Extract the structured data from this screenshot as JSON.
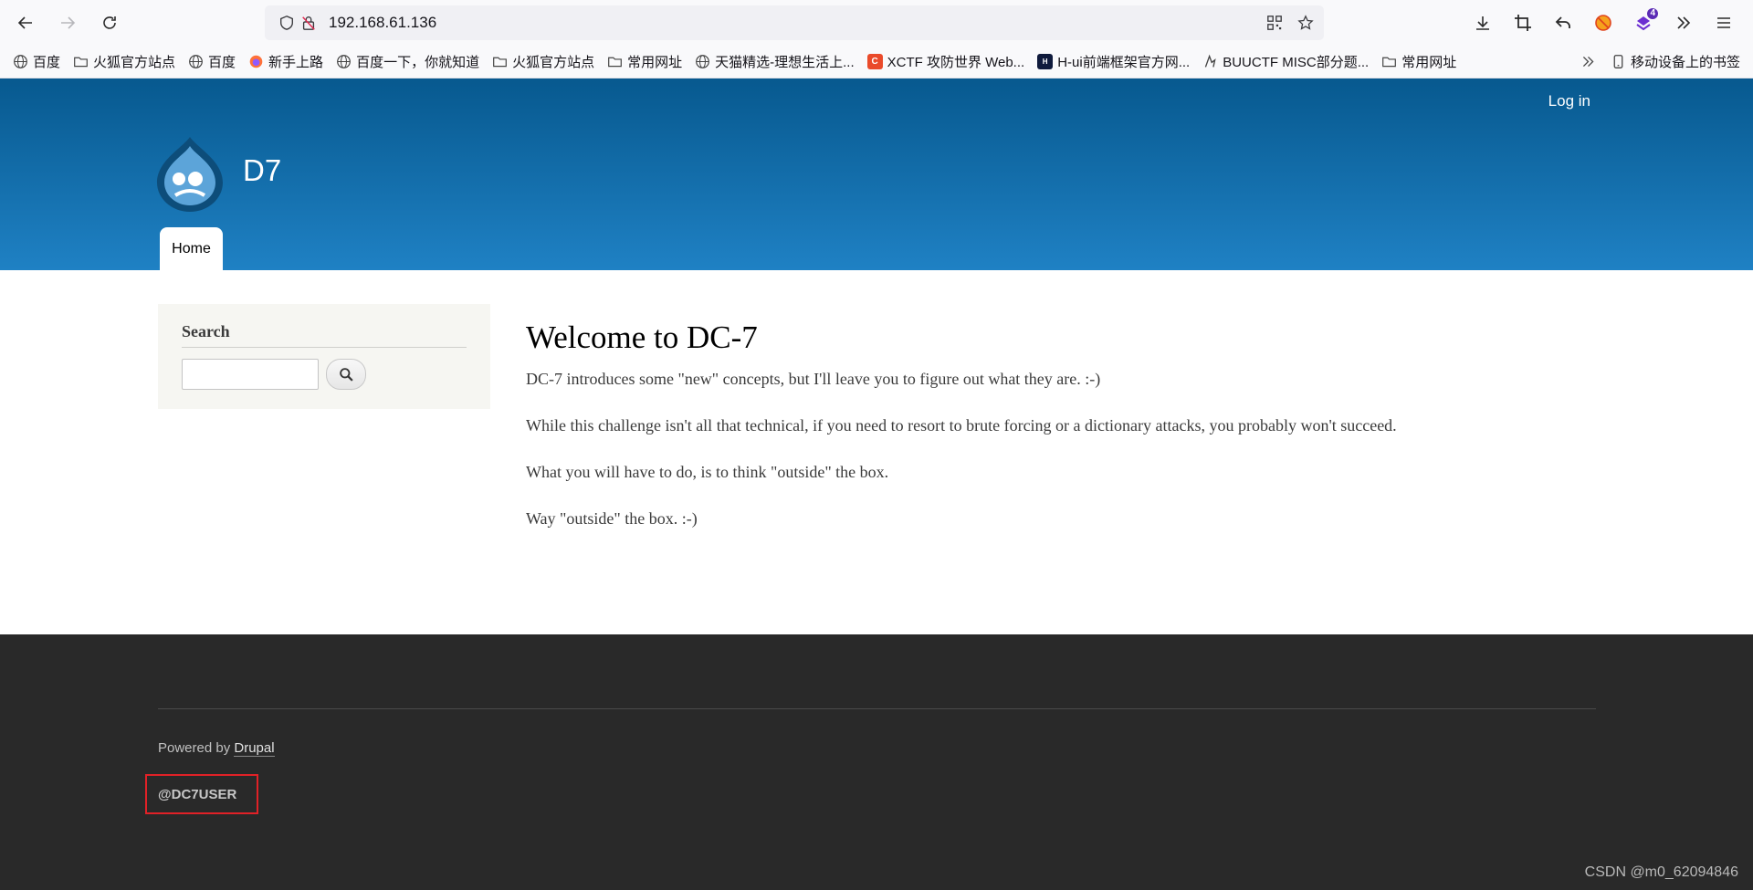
{
  "browser": {
    "url": "192.168.61.136",
    "extension_badge": "4",
    "bookmarks": [
      {
        "label": "百度",
        "icon": "globe-icon"
      },
      {
        "label": "火狐官方站点",
        "icon": "folder-icon"
      },
      {
        "label": "百度",
        "icon": "globe-icon"
      },
      {
        "label": "新手上路",
        "icon": "firefox-icon"
      },
      {
        "label": "百度一下，你就知道",
        "icon": "globe-icon"
      },
      {
        "label": "火狐官方站点",
        "icon": "folder-icon"
      },
      {
        "label": "常用网址",
        "icon": "folder-icon"
      },
      {
        "label": "天猫精选-理想生活上...",
        "icon": "globe-icon"
      },
      {
        "label": "XCTF 攻防世界 Web...",
        "icon": "xctf-icon"
      },
      {
        "label": "H-ui前端框架官方网...",
        "icon": "hui-icon"
      },
      {
        "label": "BUUCTF MISC部分题...",
        "icon": "buu-icon"
      },
      {
        "label": "常用网址",
        "icon": "folder-icon"
      }
    ],
    "mobile_bookmarks": "移动设备上的书签"
  },
  "site": {
    "login": "Log in",
    "name": "D7",
    "nav_home": "Home"
  },
  "sidebar": {
    "search_title": "Search"
  },
  "content": {
    "title": "Welcome to DC-7",
    "paragraphs": [
      "DC-7 introduces some \"new\" concepts, but I'll leave you to figure out what they are.  :-)",
      "While this challenge isn't all that technical, if you need to resort to brute forcing or a dictionary attacks, you probably won't succeed.",
      "What you will have to do, is to think \"outside\" the box.",
      "Way \"outside\" the box.  :-)"
    ]
  },
  "footer": {
    "powered_prefix": "Powered by ",
    "powered_link": "Drupal",
    "user_handle": "@DC7USER"
  },
  "watermark": "CSDN @m0_62094846",
  "colors": {
    "header_top": "#07598f",
    "header_bottom": "#1f81c4",
    "footer_bg": "#292929",
    "highlight_box": "#e12127"
  }
}
